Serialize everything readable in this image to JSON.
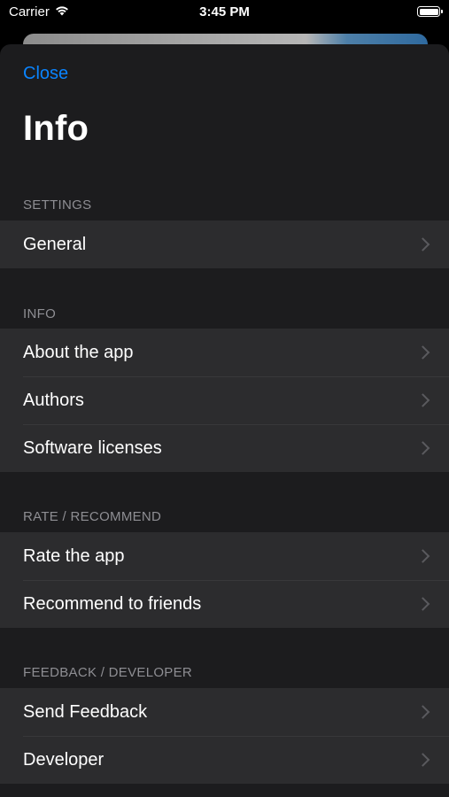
{
  "status_bar": {
    "carrier": "Carrier",
    "time": "3:45 PM"
  },
  "icons": {
    "wifi": "wifi-icon",
    "battery": "battery-icon",
    "chevron": "chevron-right-icon"
  },
  "colors": {
    "accent": "#0a84ff",
    "sheet_bg": "#1c1c1e",
    "cell_bg": "#2c2c2e",
    "section_header": "#8e8e93"
  },
  "header": {
    "close_label": "Close",
    "title": "Info"
  },
  "sections": [
    {
      "title": "SETTINGS",
      "items": [
        {
          "label": "General"
        }
      ]
    },
    {
      "title": "INFO",
      "items": [
        {
          "label": "About the app"
        },
        {
          "label": "Authors"
        },
        {
          "label": "Software licenses"
        }
      ]
    },
    {
      "title": "RATE / RECOMMEND",
      "items": [
        {
          "label": "Rate the app"
        },
        {
          "label": "Recommend to friends"
        }
      ]
    },
    {
      "title": "FEEDBACK / DEVELOPER",
      "items": [
        {
          "label": "Send Feedback"
        },
        {
          "label": "Developer"
        }
      ]
    }
  ]
}
